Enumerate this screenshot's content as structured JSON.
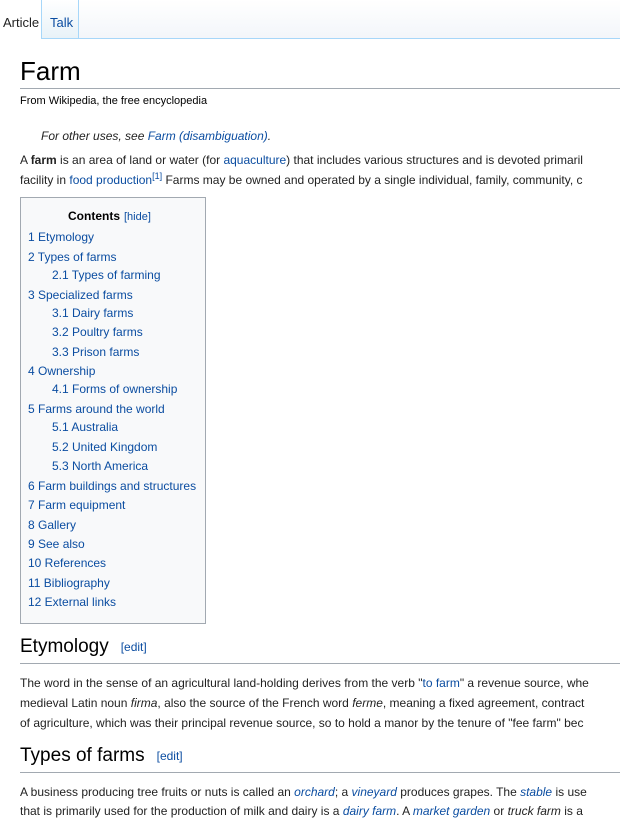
{
  "tabs": [
    {
      "label": "Article"
    },
    {
      "label": "Talk"
    }
  ],
  "article": {
    "title": "Farm",
    "tagline": "From Wikipedia, the free encyclopedia",
    "hatnote": {
      "prefix": "For other uses, see ",
      "link": "Farm (disambiguation)",
      "suffix": "."
    },
    "intro": {
      "l1_a": "A ",
      "l1_bold": "farm",
      "l1_b": " is an area of land or water (for ",
      "l1_link": "aquaculture",
      "l1_c": ") that includes various structures and is devoted primaril",
      "l2_a": "facility in ",
      "l2_link": "food production",
      "l2_ref": "[1]",
      "l2_b": " Farms may be owned and operated by a single individual, family, community, c"
    }
  },
  "toc": {
    "title": "Contents",
    "hide_label": "[hide]",
    "items": [
      {
        "label": "1 Etymology",
        "level": 1
      },
      {
        "label": "2 Types of farms",
        "level": 1
      },
      {
        "label": "2.1 Types of farming",
        "level": 2
      },
      {
        "label": "3 Specialized farms",
        "level": 1
      },
      {
        "label": "3.1 Dairy farms",
        "level": 2
      },
      {
        "label": "3.2 Poultry farms",
        "level": 2
      },
      {
        "label": "3.3 Prison farms",
        "level": 2
      },
      {
        "label": "4 Ownership",
        "level": 1
      },
      {
        "label": "4.1 Forms of ownership",
        "level": 2
      },
      {
        "label": "5 Farms around the world",
        "level": 1
      },
      {
        "label": "5.1 Australia",
        "level": 2
      },
      {
        "label": "5.2 United Kingdom",
        "level": 2
      },
      {
        "label": "5.3 North America",
        "level": 2
      },
      {
        "label": "6 Farm buildings and structures",
        "level": 1
      },
      {
        "label": "7 Farm equipment",
        "level": 1
      },
      {
        "label": "8 Gallery",
        "level": 1
      },
      {
        "label": "9 See also",
        "level": 1
      },
      {
        "label": "10 References",
        "level": 1
      },
      {
        "label": "11 Bibliography",
        "level": 1
      },
      {
        "label": "12 External links",
        "level": 1
      }
    ]
  },
  "etymology": {
    "heading": "Etymology",
    "edit_label": "[edit]",
    "l1_a": "The word in the sense of an agricultural land-holding derives from the verb \"",
    "l1_link": "to farm",
    "l1_b": "\" a revenue source, whe",
    "l2_a": "medieval Latin noun ",
    "l2_i1": "firma",
    "l2_b": ", also the source of the French word ",
    "l2_i2": "ferme",
    "l2_c": ", meaning a fixed agreement, contract",
    "l3": "of agriculture, which was their principal revenue source, so to hold a manor by the tenure of \"fee farm\" bec"
  },
  "types_of_farms": {
    "heading": "Types of farms",
    "edit_label": "[edit]",
    "l1_a": "A business producing tree fruits or nuts is called an ",
    "l1_link1": "orchard",
    "l1_b": "; a ",
    "l1_link2": "vineyard",
    "l1_c": " produces grapes. The ",
    "l1_link3": "stable",
    "l1_d": " is use",
    "l2_a": "that is primarily used for the production of milk and dairy is a ",
    "l2_link1": "dairy farm",
    "l2_b": ". A ",
    "l2_link2": "market garden",
    "l2_c": " or ",
    "l2_i": "truck farm",
    "l2_d": " is a"
  }
}
